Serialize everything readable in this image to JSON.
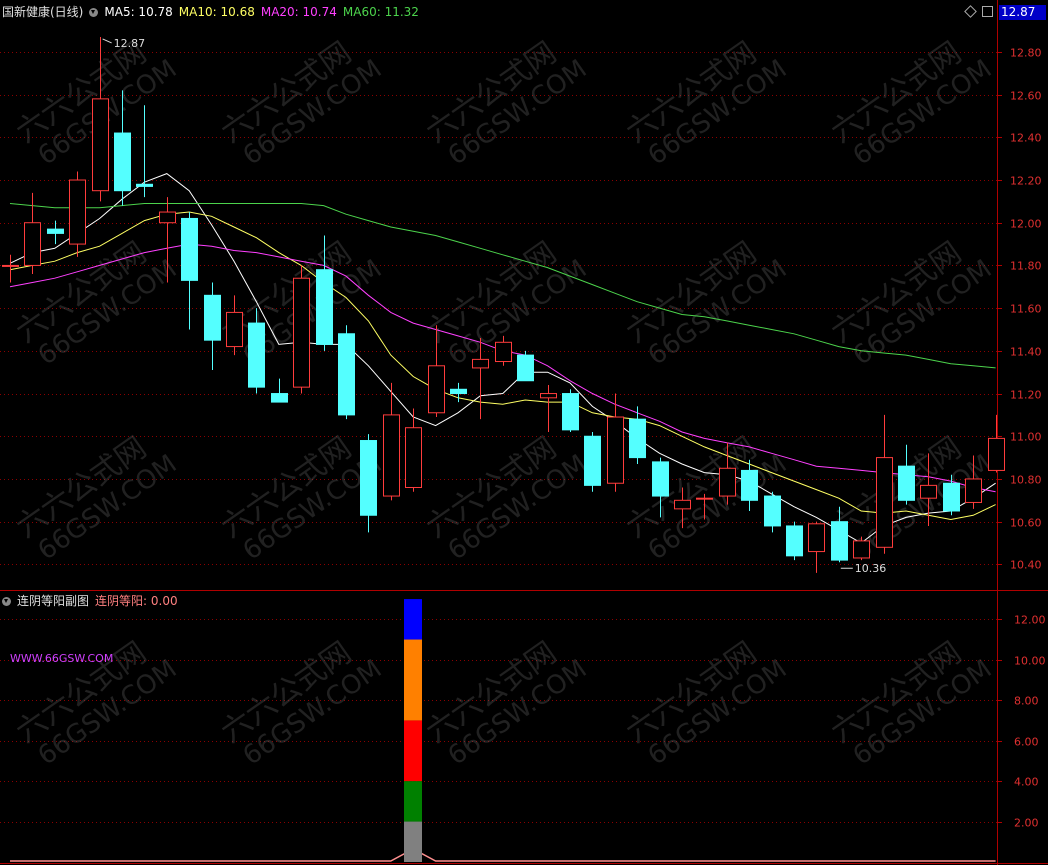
{
  "main_header": {
    "title": "国新健康(日线)",
    "ma5": "MA5: 10.78",
    "ma10": "MA10: 10.68",
    "ma20": "MA20: 10.74",
    "ma60": "MA60: 11.32"
  },
  "price_tag": "12.87",
  "sub_header": {
    "title": "连阴等阳副图",
    "indicator": "连阴等阳: 0.00"
  },
  "url_label": "WWW.66GSW.COM",
  "watermark": {
    "line1": "六六公式网",
    "line2": "66GSW.COM"
  },
  "colors": {
    "up": "#ff3c3c",
    "down": "#54ffff",
    "ma5": "#ffffff",
    "ma10": "#ffff64",
    "ma20": "#ff40ff",
    "ma60": "#4cd34c",
    "grid": "#8b0000",
    "axis": "#b00000"
  },
  "chart_data": [
    {
      "type": "candlestick",
      "title": "国新健康(日线)",
      "ylim": [
        10.28,
        12.94
      ],
      "yticks": [
        "12.80",
        "12.60",
        "12.40",
        "12.20",
        "12.00",
        "11.80",
        "11.60",
        "11.40",
        "11.20",
        "11.00",
        "10.80",
        "10.60",
        "10.40"
      ],
      "annotations": [
        {
          "label": "12.87",
          "index": 4
        },
        {
          "label": "10.36",
          "index": 37
        }
      ],
      "candles": [
        {
          "o": 11.8,
          "h": 11.85,
          "l": 11.72,
          "c": 11.8
        },
        {
          "o": 11.8,
          "h": 12.14,
          "l": 11.76,
          "c": 12.0
        },
        {
          "o": 11.97,
          "h": 12.01,
          "l": 11.9,
          "c": 11.95
        },
        {
          "o": 11.9,
          "h": 12.24,
          "l": 11.84,
          "c": 12.2
        },
        {
          "o": 12.15,
          "h": 12.87,
          "l": 12.1,
          "c": 12.58
        },
        {
          "o": 12.42,
          "h": 12.62,
          "l": 12.08,
          "c": 12.15
        },
        {
          "o": 12.18,
          "h": 12.55,
          "l": 12.12,
          "c": 12.17
        },
        {
          "o": 12.0,
          "h": 12.12,
          "l": 11.72,
          "c": 12.05
        },
        {
          "o": 12.02,
          "h": 12.05,
          "l": 11.5,
          "c": 11.73
        },
        {
          "o": 11.66,
          "h": 11.72,
          "l": 11.31,
          "c": 11.45
        },
        {
          "o": 11.42,
          "h": 11.66,
          "l": 11.38,
          "c": 11.58
        },
        {
          "o": 11.53,
          "h": 11.6,
          "l": 11.2,
          "c": 11.23
        },
        {
          "o": 11.2,
          "h": 11.27,
          "l": 11.17,
          "c": 11.16
        },
        {
          "o": 11.23,
          "h": 11.8,
          "l": 11.2,
          "c": 11.74
        },
        {
          "o": 11.78,
          "h": 11.94,
          "l": 11.4,
          "c": 11.43
        },
        {
          "o": 11.48,
          "h": 11.52,
          "l": 11.08,
          "c": 11.1
        },
        {
          "o": 10.98,
          "h": 11.01,
          "l": 10.55,
          "c": 10.63
        },
        {
          "o": 10.72,
          "h": 11.25,
          "l": 10.7,
          "c": 11.1
        },
        {
          "o": 10.76,
          "h": 11.13,
          "l": 10.74,
          "c": 11.04
        },
        {
          "o": 11.11,
          "h": 11.52,
          "l": 11.09,
          "c": 11.33
        },
        {
          "o": 11.22,
          "h": 11.25,
          "l": 11.16,
          "c": 11.2
        },
        {
          "o": 11.32,
          "h": 11.46,
          "l": 11.08,
          "c": 11.36
        },
        {
          "o": 11.35,
          "h": 11.47,
          "l": 11.33,
          "c": 11.44
        },
        {
          "o": 11.38,
          "h": 11.4,
          "l": 11.26,
          "c": 11.26
        },
        {
          "o": 11.18,
          "h": 11.24,
          "l": 11.02,
          "c": 11.2
        },
        {
          "o": 11.2,
          "h": 11.22,
          "l": 11.02,
          "c": 11.03
        },
        {
          "o": 11.0,
          "h": 11.02,
          "l": 10.74,
          "c": 10.77
        },
        {
          "o": 10.78,
          "h": 11.2,
          "l": 10.74,
          "c": 11.09
        },
        {
          "o": 11.08,
          "h": 11.14,
          "l": 10.87,
          "c": 10.9
        },
        {
          "o": 10.88,
          "h": 10.9,
          "l": 10.62,
          "c": 10.72
        },
        {
          "o": 10.66,
          "h": 10.76,
          "l": 10.57,
          "c": 10.7
        },
        {
          "o": 10.71,
          "h": 10.73,
          "l": 10.61,
          "c": 10.71
        },
        {
          "o": 10.72,
          "h": 10.97,
          "l": 10.68,
          "c": 10.85
        },
        {
          "o": 10.84,
          "h": 10.89,
          "l": 10.65,
          "c": 10.7
        },
        {
          "o": 10.72,
          "h": 10.74,
          "l": 10.55,
          "c": 10.58
        },
        {
          "o": 10.58,
          "h": 10.6,
          "l": 10.42,
          "c": 10.44
        },
        {
          "o": 10.46,
          "h": 10.6,
          "l": 10.36,
          "c": 10.59
        },
        {
          "o": 10.6,
          "h": 10.67,
          "l": 10.41,
          "c": 10.42
        },
        {
          "o": 10.43,
          "h": 10.53,
          "l": 10.42,
          "c": 10.51
        },
        {
          "o": 10.48,
          "h": 11.1,
          "l": 10.45,
          "c": 10.9
        },
        {
          "o": 10.86,
          "h": 10.96,
          "l": 10.68,
          "c": 10.7
        },
        {
          "o": 10.71,
          "h": 10.92,
          "l": 10.58,
          "c": 10.77
        },
        {
          "o": 10.78,
          "h": 10.82,
          "l": 10.63,
          "c": 10.65
        },
        {
          "o": 10.69,
          "h": 10.91,
          "l": 10.66,
          "c": 10.8
        },
        {
          "o": 10.84,
          "h": 11.1,
          "l": 10.83,
          "c": 10.99
        }
      ],
      "series": [
        {
          "name": "MA5",
          "values": [
            11.81,
            11.86,
            11.88,
            11.95,
            12.02,
            12.11,
            12.19,
            12.23,
            12.15,
            11.99,
            11.82,
            11.63,
            11.43,
            11.44,
            11.43,
            11.43,
            11.33,
            11.21,
            11.09,
            11.05,
            11.11,
            11.19,
            11.2,
            11.3,
            11.3,
            11.25,
            11.14,
            11.07,
            10.99,
            10.92,
            10.87,
            10.83,
            10.82,
            10.79,
            10.73,
            10.67,
            10.62,
            10.56,
            10.5,
            10.58,
            10.62,
            10.64,
            10.65,
            10.71,
            10.78
          ]
        },
        {
          "name": "MA10",
          "values": [
            11.78,
            11.8,
            11.82,
            11.86,
            11.89,
            11.95,
            12.01,
            12.04,
            12.05,
            12.03,
            11.98,
            11.93,
            11.86,
            11.8,
            11.72,
            11.65,
            11.54,
            11.38,
            11.28,
            11.22,
            11.18,
            11.16,
            11.15,
            11.17,
            11.16,
            11.16,
            11.11,
            11.09,
            11.08,
            11.05,
            11.0,
            10.95,
            10.91,
            10.87,
            10.83,
            10.79,
            10.75,
            10.71,
            10.65,
            10.64,
            10.65,
            10.63,
            10.61,
            10.63,
            10.68
          ]
        },
        {
          "name": "MA20",
          "values": [
            11.7,
            11.72,
            11.74,
            11.77,
            11.8,
            11.83,
            11.86,
            11.88,
            11.9,
            11.89,
            11.87,
            11.86,
            11.84,
            11.82,
            11.8,
            11.75,
            11.66,
            11.58,
            11.53,
            11.5,
            11.47,
            11.44,
            11.4,
            11.38,
            11.33,
            11.26,
            11.2,
            11.15,
            11.11,
            11.07,
            11.02,
            10.99,
            10.97,
            10.95,
            10.92,
            10.89,
            10.86,
            10.85,
            10.84,
            10.83,
            10.82,
            10.81,
            10.79,
            10.76,
            10.74
          ]
        },
        {
          "name": "MA60",
          "values": [
            12.09,
            12.08,
            12.07,
            12.07,
            12.07,
            12.08,
            12.09,
            12.09,
            12.09,
            12.09,
            12.09,
            12.09,
            12.09,
            12.09,
            12.08,
            12.04,
            12.01,
            11.98,
            11.96,
            11.94,
            11.91,
            11.88,
            11.85,
            11.82,
            11.79,
            11.75,
            11.71,
            11.67,
            11.63,
            11.6,
            11.57,
            11.56,
            11.54,
            11.52,
            11.5,
            11.48,
            11.45,
            11.42,
            11.4,
            11.39,
            11.38,
            11.36,
            11.34,
            11.33,
            11.32
          ]
        }
      ]
    },
    {
      "type": "bar",
      "title": "连阴等阳副图",
      "ylim": [
        0,
        13.3
      ],
      "yticks": [
        "12.00",
        "10.00",
        "8.00",
        "6.00",
        "4.00",
        "2.00"
      ],
      "spike_index": 18,
      "stack_segments": [
        {
          "from": 0,
          "to": 2,
          "color": "#808080"
        },
        {
          "from": 2,
          "to": 4,
          "color": "#008000"
        },
        {
          "from": 4,
          "to": 7,
          "color": "#ff0000"
        },
        {
          "from": 7,
          "to": 11,
          "color": "#ff8000"
        },
        {
          "from": 11,
          "to": 13,
          "color": "#0000ff"
        }
      ],
      "line_values": [
        0,
        0,
        0,
        0,
        0,
        0,
        0,
        0,
        0,
        0,
        0,
        0,
        0,
        0,
        0,
        0,
        0,
        0,
        1,
        0,
        0,
        0,
        0,
        0,
        0,
        0,
        0,
        0,
        0,
        0,
        0,
        0,
        0,
        0,
        0,
        0,
        0,
        0,
        0,
        0,
        0,
        0,
        0,
        0,
        0
      ]
    }
  ]
}
